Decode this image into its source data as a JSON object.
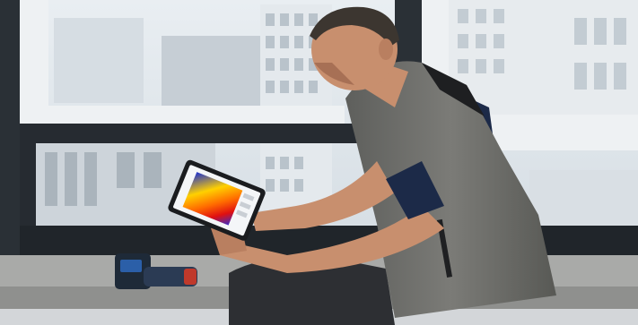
{
  "scene": {
    "subject": "man-using-tablet-thermal-image",
    "colors": {
      "sky": "#dfe6ec",
      "frame_white": "#eef1f3",
      "frame_dark": "#22272c",
      "sill": "#a9aaa8",
      "vest": "#6f6f6c",
      "shirt": "#1c2a48",
      "skin": "#c88f6e",
      "trousers": "#2d2f33",
      "camera_body": "#1e2a38",
      "camera_accent": "#2b5fa8"
    },
    "icons": [
      "thermal-camera-icon",
      "tablet-icon"
    ]
  }
}
